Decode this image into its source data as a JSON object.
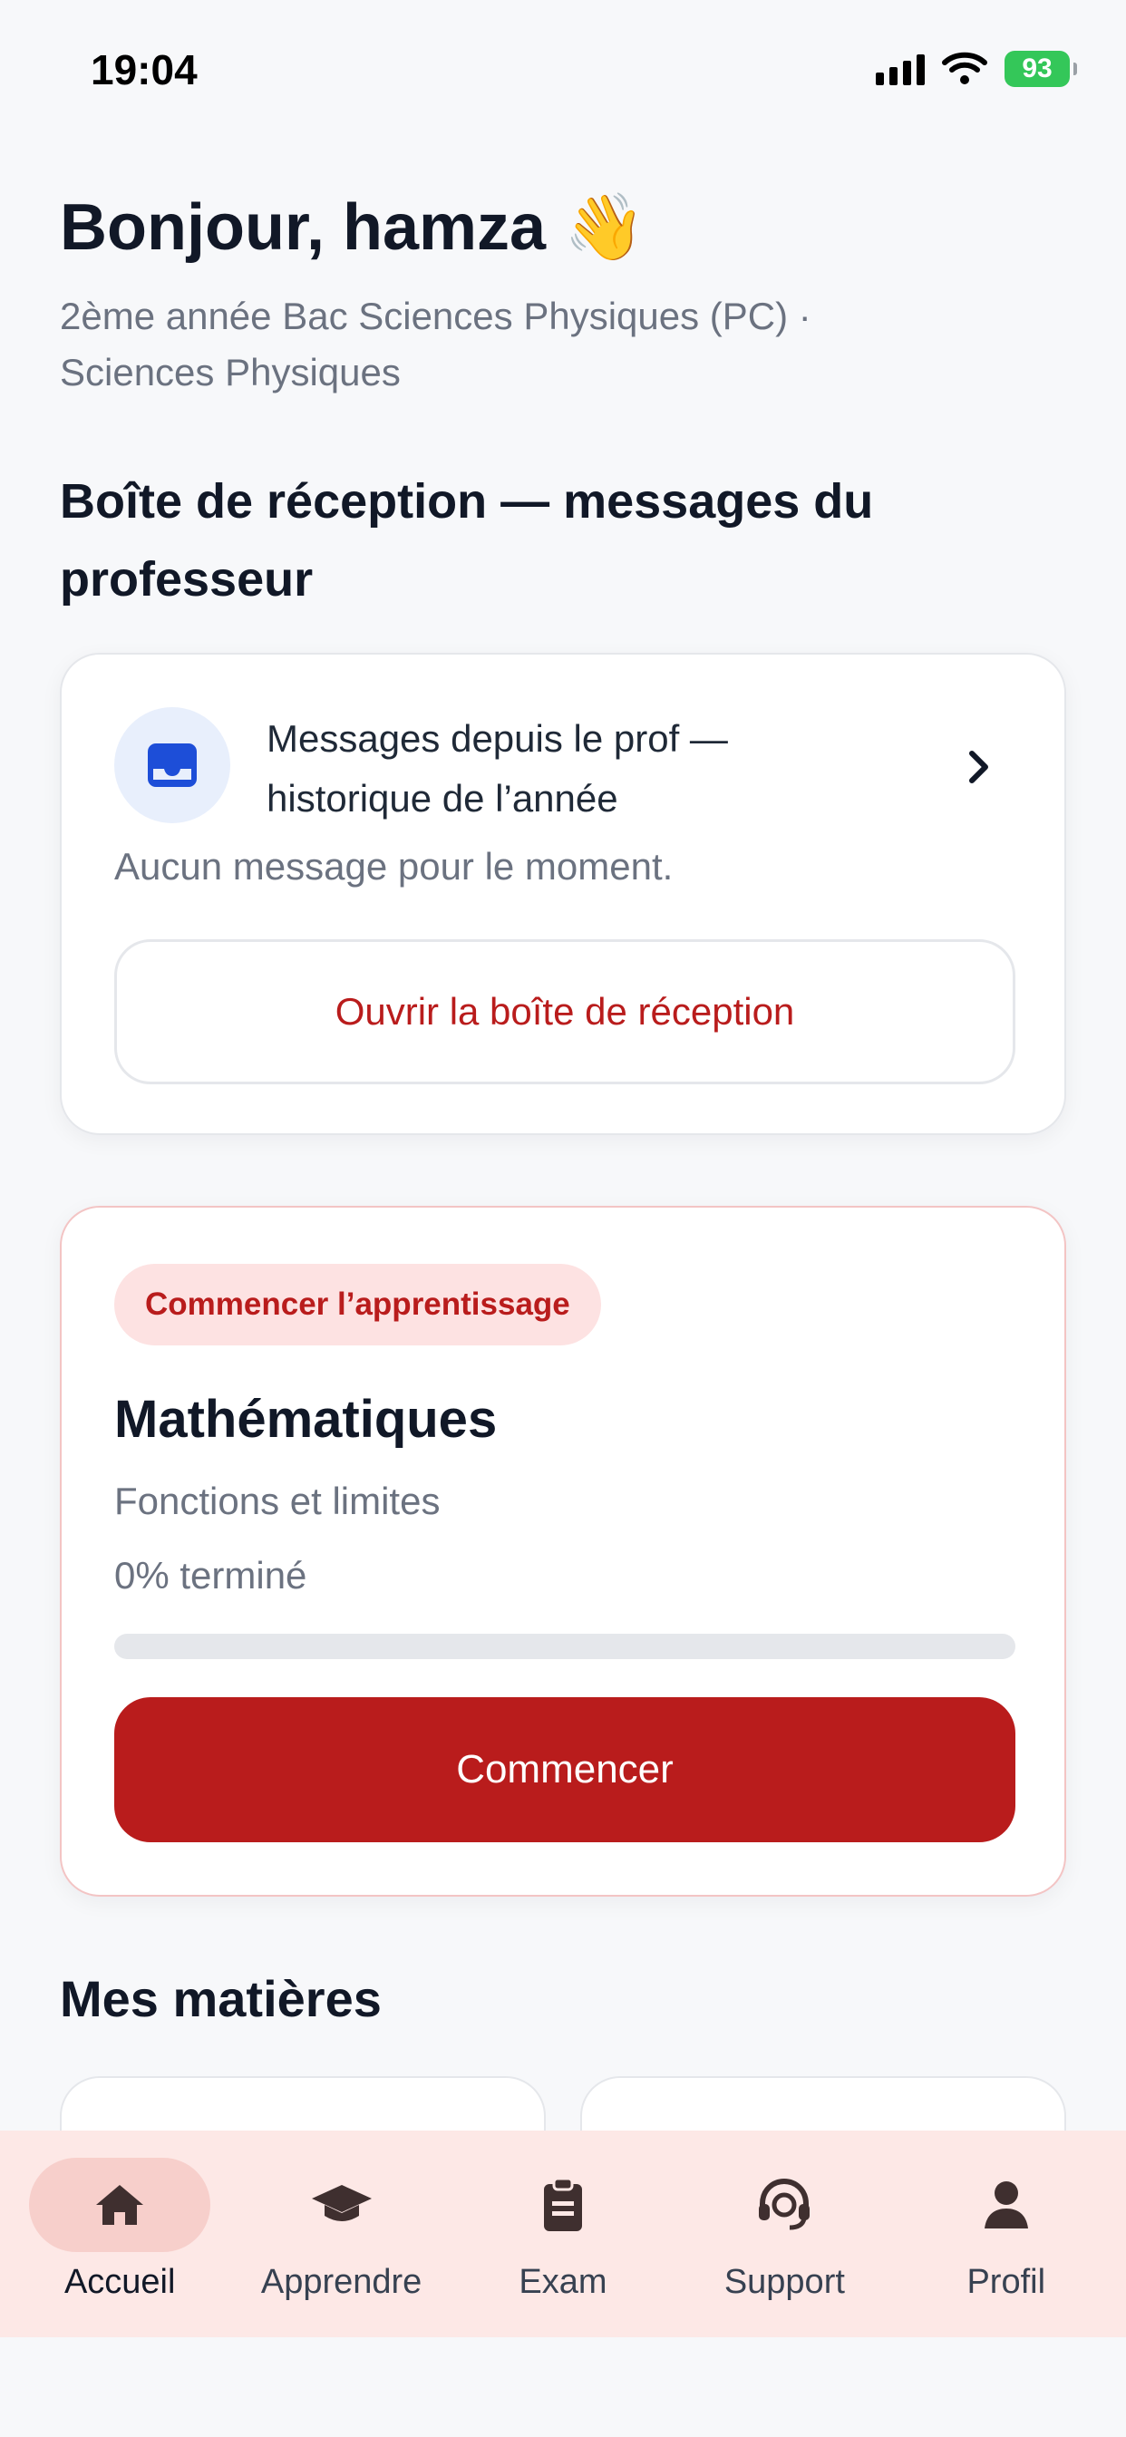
{
  "status_bar": {
    "time": "19:04",
    "battery": "93"
  },
  "greeting": {
    "title": "Bonjour, hamza 👋",
    "subtitle": "2ème année Bac Sciences Physiques (PC) · Sciences Physiques"
  },
  "inbox_section": {
    "title": "Boîte de réception — messages du professeur",
    "card_title": "Messages depuis le prof — historique de l’année",
    "empty_text": "Aucun message pour le moment.",
    "open_button": "Ouvrir la boîte de réception",
    "icon": "inbox-icon"
  },
  "learning_card": {
    "pill": "Commencer l’apprentissage",
    "subject": "Mathématiques",
    "chapter": "Fonctions et limites",
    "progress_text": "0% terminé",
    "progress_percent": 0,
    "start_button": "Commencer"
  },
  "subjects": {
    "title": "Mes matières"
  },
  "bottom_nav": [
    {
      "label": "Accueil",
      "icon": "home-icon",
      "active": true
    },
    {
      "label": "Apprendre",
      "icon": "graduation-cap-icon",
      "active": false
    },
    {
      "label": "Exam",
      "icon": "clipboard-icon",
      "active": false
    },
    {
      "label": "Support",
      "icon": "headset-icon",
      "active": false
    },
    {
      "label": "Profil",
      "icon": "user-icon",
      "active": false
    }
  ],
  "colors": {
    "accent": "#b91c1c",
    "pill_bg": "#fde2e2",
    "nav_bg": "#fde8e6",
    "battery": "#34c759"
  }
}
